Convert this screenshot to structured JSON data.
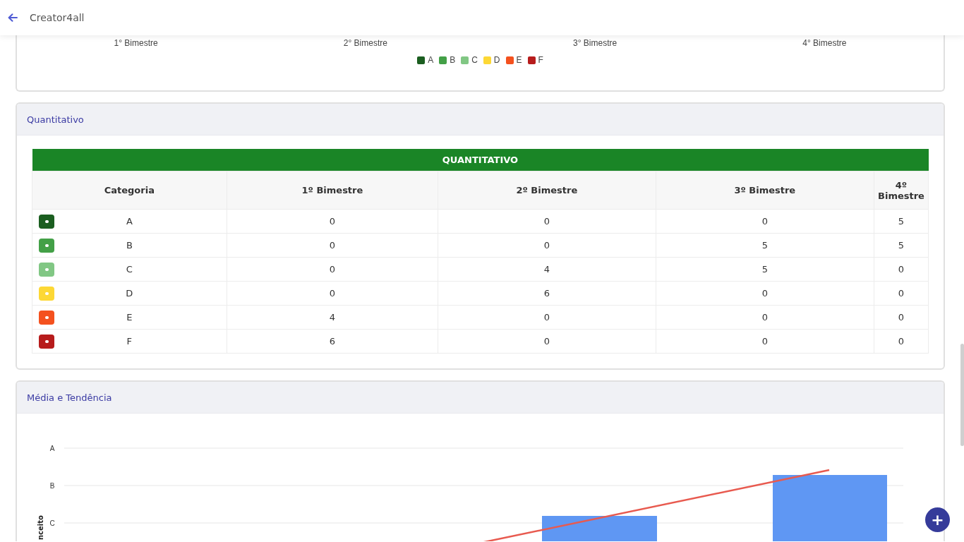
{
  "app_bar": {
    "title": "Creator4all"
  },
  "grade_chart": {
    "x_labels": [
      "1° Bimestre",
      "2° Bimestre",
      "3° Bimestre",
      "4° Bimestre"
    ],
    "legend": [
      {
        "label": "A",
        "color": "#1b5e20"
      },
      {
        "label": "B",
        "color": "#43a047"
      },
      {
        "label": "C",
        "color": "#81c784"
      },
      {
        "label": "D",
        "color": "#fdd835"
      },
      {
        "label": "E",
        "color": "#f4511e"
      },
      {
        "label": "F",
        "color": "#b71c1c"
      }
    ]
  },
  "quantitativo": {
    "title": "Quantitativo",
    "table": {
      "caption": "QUANTITATIVO",
      "columns": [
        "Categoria",
        "1º Bimestre",
        "2º Bimestre",
        "3º Bimestre",
        "4º Bimestre"
      ],
      "rows": [
        {
          "category": "A",
          "color": "#1b5e20",
          "values": [
            "0",
            "0",
            "0",
            "5"
          ]
        },
        {
          "category": "B",
          "color": "#43a047",
          "values": [
            "0",
            "0",
            "5",
            "5"
          ]
        },
        {
          "category": "C",
          "color": "#81c784",
          "values": [
            "0",
            "4",
            "5",
            "0"
          ]
        },
        {
          "category": "D",
          "color": "#fdd835",
          "values": [
            "0",
            "6",
            "0",
            "0"
          ]
        },
        {
          "category": "E",
          "color": "#f4511e",
          "values": [
            "4",
            "0",
            "0",
            "0"
          ]
        },
        {
          "category": "F",
          "color": "#b71c1c",
          "values": [
            "6",
            "0",
            "0",
            "0"
          ]
        }
      ]
    }
  },
  "media": {
    "title": "Média e Tendência",
    "chart": {
      "y_ticks": [
        "A",
        "B",
        "C"
      ],
      "ylabel": "nceito"
    }
  },
  "fab": {
    "label": "+"
  }
}
